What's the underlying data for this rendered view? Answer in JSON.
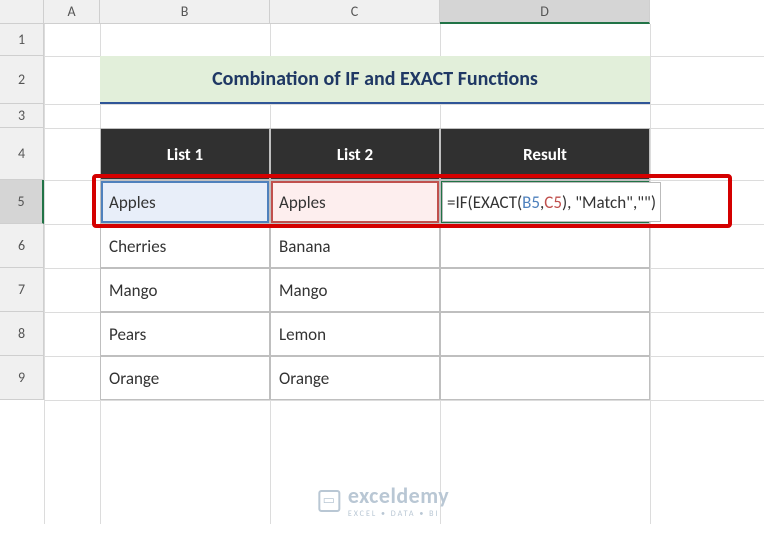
{
  "columns": [
    "A",
    "B",
    "C",
    "D"
  ],
  "rows": [
    "1",
    "2",
    "3",
    "4",
    "5",
    "6",
    "7",
    "8",
    "9"
  ],
  "title": "Combination of IF and EXACT Functions",
  "headers": {
    "b": "List 1",
    "c": "List 2",
    "d": "Result"
  },
  "table": {
    "b": [
      "Apples",
      "Cherries",
      "Mango",
      "Pears",
      "Orange"
    ],
    "c": [
      "Apples",
      "Banana",
      "Mango",
      "Lemon",
      "Orange"
    ]
  },
  "formula": {
    "parts": {
      "p1": "=IF(",
      "p2": "EXACT(",
      "p3": "B5",
      "p4": ",",
      "p5": "C5",
      "p6": ")",
      "p7": ", \"Match\",\"\")"
    }
  },
  "active_cell": "D5",
  "watermark": {
    "name": "exceldemy",
    "tagline": "EXCEL • DATA • BI"
  },
  "chart_data": {
    "type": "table",
    "title": "Combination of IF and EXACT Functions",
    "columns": [
      "List 1",
      "List 2",
      "Result"
    ],
    "rows": [
      [
        "Apples",
        "Apples",
        "=IF(EXACT(B5,C5), \"Match\",\"\")"
      ],
      [
        "Cherries",
        "Banana",
        ""
      ],
      [
        "Mango",
        "Mango",
        ""
      ],
      [
        "Pears",
        "Lemon",
        ""
      ],
      [
        "Orange",
        "Orange",
        ""
      ]
    ]
  }
}
